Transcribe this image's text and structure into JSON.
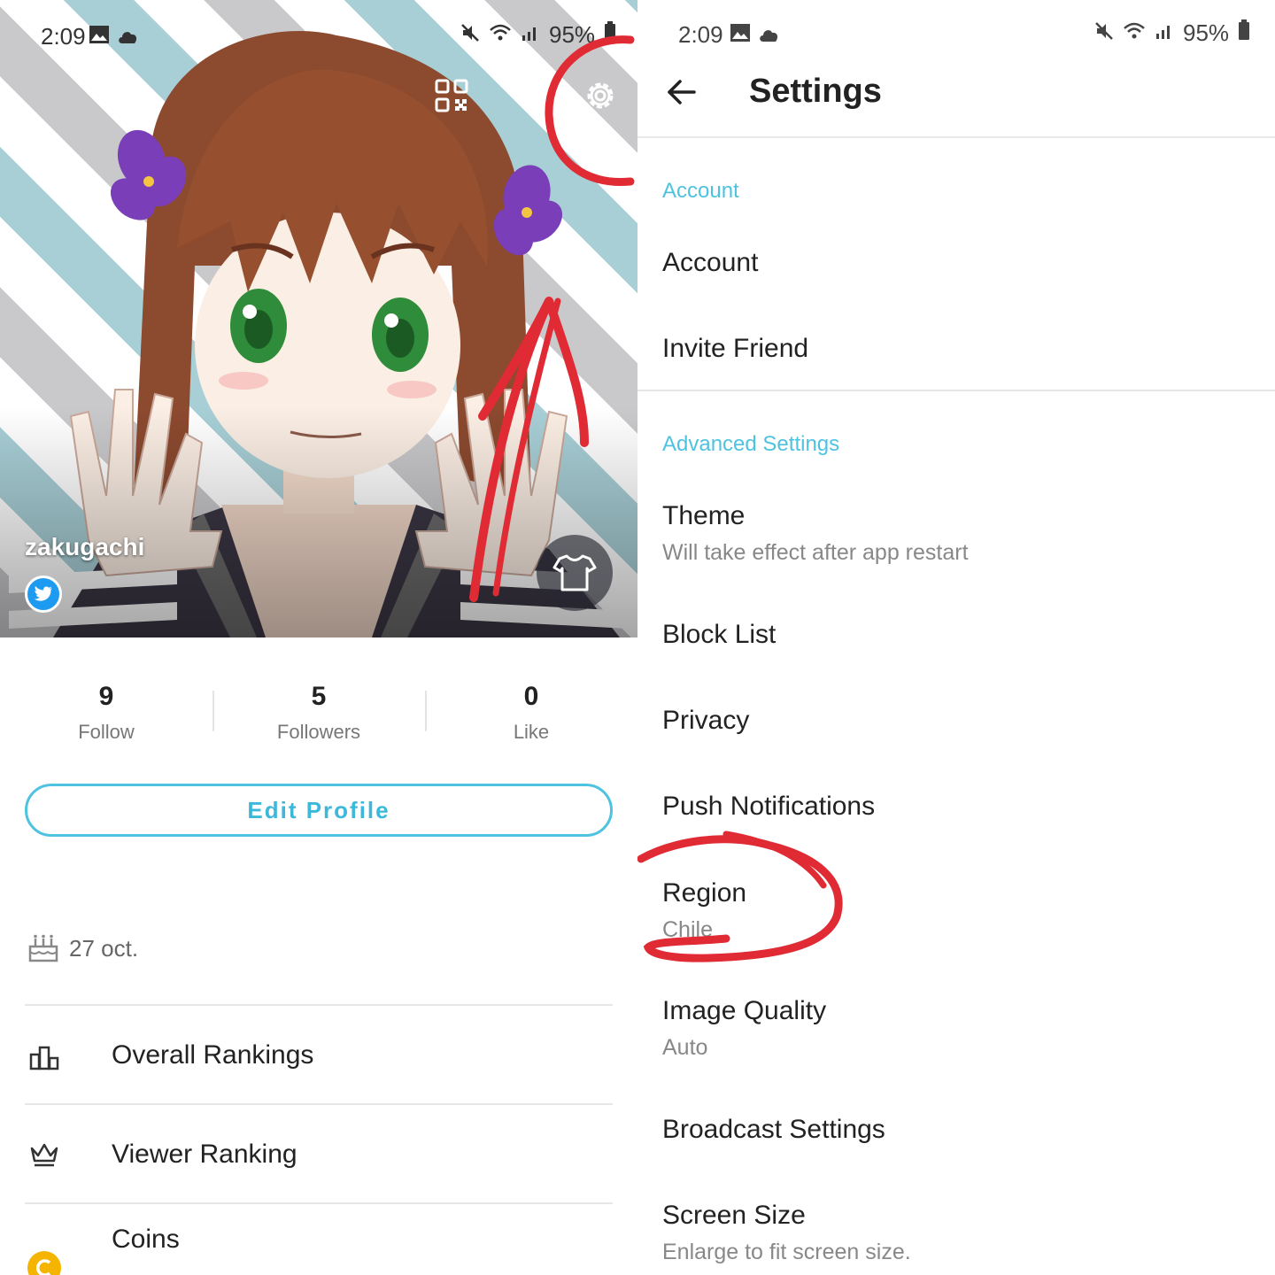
{
  "left": {
    "status_bar": {
      "time": "2:09",
      "battery": "95%"
    },
    "profile": {
      "username": "zakugachi"
    },
    "stats": [
      {
        "value": "9",
        "label": "Follow"
      },
      {
        "value": "5",
        "label": "Followers"
      },
      {
        "value": "0",
        "label": "Like"
      }
    ],
    "edit_profile_label": "Edit Profile",
    "birthday": "27 oct.",
    "menu": [
      {
        "label": "Overall Rankings",
        "icon": "podium-icon"
      },
      {
        "label": "Viewer Ranking",
        "icon": "crown-icon"
      },
      {
        "label": "Coins",
        "icon": "coin-icon"
      }
    ]
  },
  "right": {
    "status_bar": {
      "time": "2:09",
      "battery": "95%"
    },
    "title": "Settings",
    "sections": [
      {
        "header": "Account",
        "items": [
          {
            "title": "Account"
          },
          {
            "title": "Invite Friend"
          }
        ]
      },
      {
        "header": "Advanced Settings",
        "items": [
          {
            "title": "Theme",
            "subtitle": "Will take effect after app restart"
          },
          {
            "title": "Block List"
          },
          {
            "title": "Privacy"
          },
          {
            "title": "Push Notifications"
          },
          {
            "title": "Region",
            "subtitle": "Chile"
          },
          {
            "title": "Image Quality",
            "subtitle": "Auto"
          },
          {
            "title": "Broadcast Settings"
          },
          {
            "title": "Screen Size",
            "subtitle": "Enlarge to fit screen size."
          }
        ]
      }
    ]
  },
  "colors": {
    "accent": "#4ec3e0",
    "annotation_red": "#e02b35",
    "twitter": "#1d9bf0"
  }
}
